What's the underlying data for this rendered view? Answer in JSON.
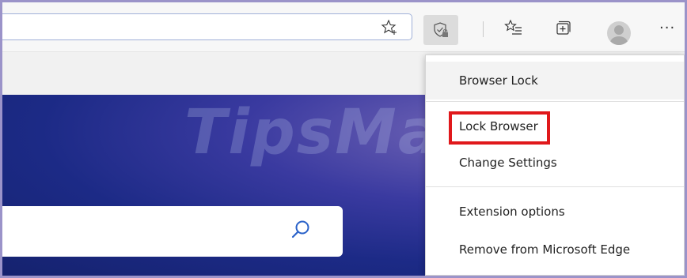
{
  "toolbar": {
    "favorites_add_icon": "star-plus-icon",
    "extension_icon": "shield-lock-icon",
    "favorites_icon": "favorites-list-icon",
    "collections_icon": "collections-icon",
    "profile_icon": "avatar",
    "more_label": "···"
  },
  "watermark": {
    "text": "TipsMake"
  },
  "menu": {
    "header": "Browser Lock",
    "items": [
      {
        "label": "Lock Browser"
      },
      {
        "label": "Change Settings"
      },
      {
        "label": "Extension options"
      },
      {
        "label": "Remove from Microsoft Edge"
      }
    ]
  },
  "colors": {
    "highlight": "#e0181b",
    "content_bg": "#1c2a86",
    "frame_border": "#9b93c9"
  }
}
